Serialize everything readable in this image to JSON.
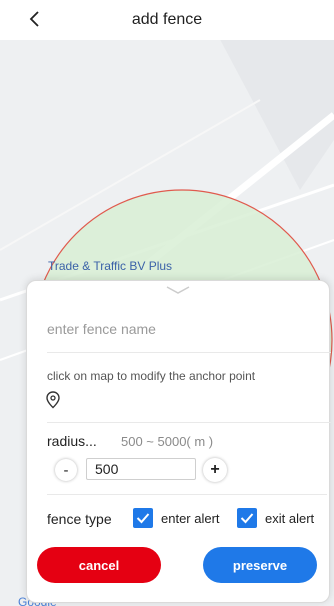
{
  "header": {
    "title": "add fence",
    "back_icon": "chevron-left-icon"
  },
  "map": {
    "place_label": "Trade & Traffic BV Plus",
    "provider_logo": "Google",
    "circle_color": "#e05a4e",
    "circle_fill": "#d8efd5"
  },
  "form": {
    "name_placeholder": "enter fence name",
    "anchor_hint": "click on map to modify the anchor point",
    "anchor_icon": "map-pin-icon",
    "radius_label": "radius...",
    "radius_range": "500 ~ 5000( m )",
    "minus_label": "-",
    "plus_label": "+",
    "radius_value": "500",
    "fence_type_label": "fence type",
    "enter_alert_label": "enter alert",
    "exit_alert_label": "exit alert",
    "enter_alert_checked": true,
    "exit_alert_checked": true
  },
  "actions": {
    "cancel_label": "cancel",
    "preserve_label": "preserve"
  },
  "colors": {
    "primary": "#1f79e8",
    "danger": "#e50012"
  }
}
